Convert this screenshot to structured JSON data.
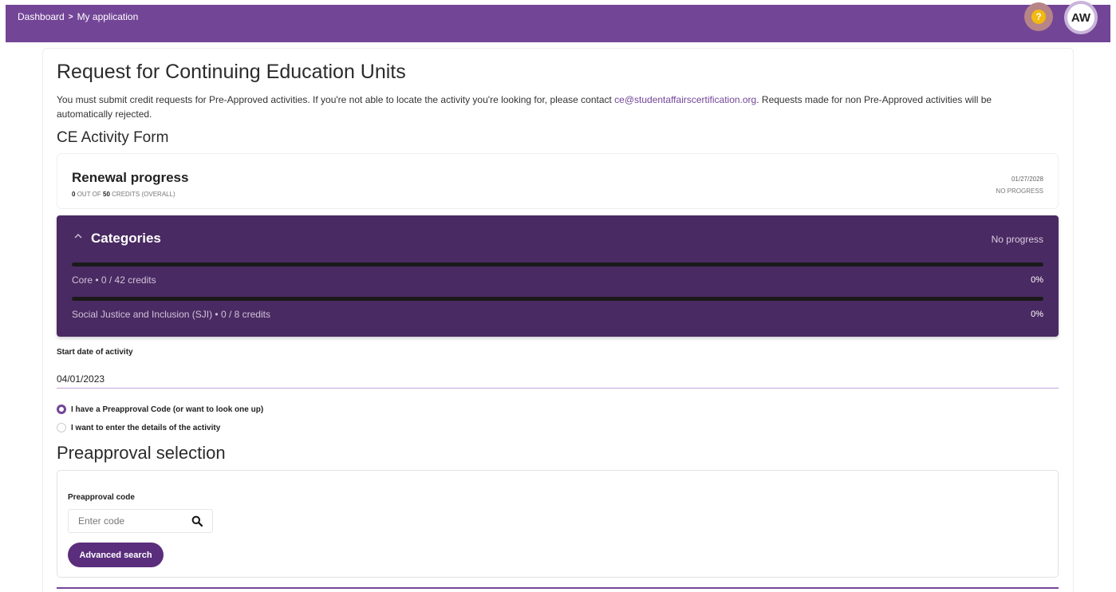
{
  "header": {
    "breadcrumb": [
      "Dashboard",
      "My application"
    ],
    "breadcrumb_separator": ">",
    "help_icon_glyph": "?",
    "avatar_initials": "AW",
    "brand_color": "#734597"
  },
  "page": {
    "title": "Request for Continuing Education Units",
    "intro_before": "You must submit credit requests for Pre-Approved activities. If you're not able to locate the activity you're looking for, please contact ",
    "intro_email": "ce@studentaffairscertification.org",
    "intro_after": ". Requests made for non Pre-Approved activities will be automatically rejected.",
    "form_title": "CE Activity Form"
  },
  "renewal": {
    "title": "Renewal progress",
    "earned": "0",
    "sub_mid": "OUT OF",
    "total": "50",
    "sub_end": "CREDITS (OVERALL)",
    "date": "01/27/2028",
    "status": "NO PROGRESS"
  },
  "categories": {
    "title": "Categories",
    "status": "No progress",
    "items": [
      {
        "label": "Core • 0 / 42 credits",
        "percent": "0%",
        "progress": 0
      },
      {
        "label": "Social Justice and Inclusion (SJI) • 0 / 8 credits",
        "percent": "0%",
        "progress": 0
      }
    ]
  },
  "form": {
    "start_date_label": "Start date of activity",
    "start_date_value": "04/01/2023",
    "radio_options": [
      {
        "label": "I have a Preapproval Code (or want to look one up)",
        "selected": true
      },
      {
        "label": "I want to enter the details of the activity",
        "selected": false
      }
    ]
  },
  "preapproval": {
    "title": "Preapproval selection",
    "code_label": "Preapproval code",
    "code_placeholder": "Enter code",
    "code_value": "",
    "search_icon": "search-icon",
    "advanced_button": "Advanced search"
  }
}
